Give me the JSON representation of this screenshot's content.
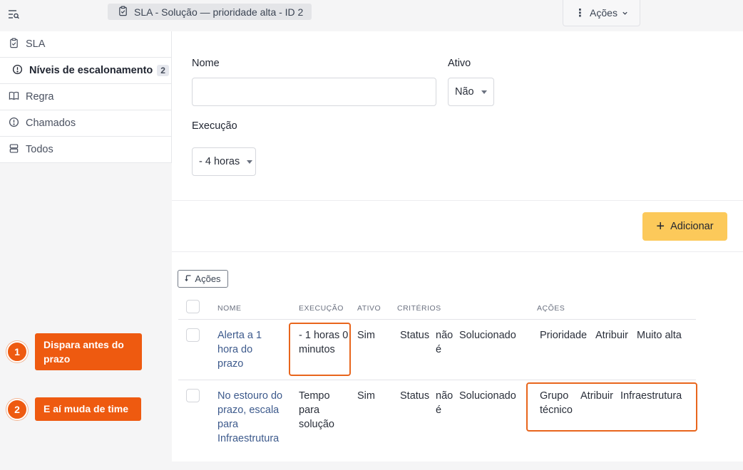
{
  "breadcrumb": {
    "text": "SLA -  Solução — prioridade alta - ID 2"
  },
  "header": {
    "actions_label": "Ações"
  },
  "sidebar": {
    "items": [
      {
        "label": "SLA",
        "icon": "clipboard-check-icon"
      },
      {
        "label": "Níveis de escalonamento",
        "icon": "alert-circle-icon",
        "badge": "2"
      },
      {
        "label": "Regra",
        "icon": "book-icon"
      },
      {
        "label": "Chamados",
        "icon": "alert-circle-icon"
      },
      {
        "label": "Todos",
        "icon": "server-icon"
      }
    ]
  },
  "form": {
    "name_label": "Nome",
    "name_value": "",
    "active_label": "Ativo",
    "active_value": "Não",
    "execution_label": "Execução",
    "execution_value": "- 4 horas",
    "add_button": "Adicionar"
  },
  "table": {
    "mass_actions_label": "Ações",
    "headers": {
      "name": "NOME",
      "execution": "EXECUÇÃO",
      "active": "ATIVO",
      "criteria": "CRITÉRIOS",
      "actions": "AÇÕES"
    },
    "rows": [
      {
        "name": "Alerta a 1 hora do prazo",
        "execution": "- 1 horas 0 minutos",
        "active": "Sim",
        "criteria_field": "Status",
        "criteria_op": "não é",
        "criteria_value": "Solucionado",
        "action_field": "Prioridade",
        "action_type": "Atribuir",
        "action_value": "Muito alta"
      },
      {
        "name": "No estouro do prazo, escala para Infraestrutura",
        "execution": "Tempo para solução",
        "active": "Sim",
        "criteria_field": "Status",
        "criteria_op": "não é",
        "criteria_value": "Solucionado",
        "action_field": "Grupo técnico",
        "action_type": "Atribuir",
        "action_value": "Infraestrutura"
      }
    ]
  },
  "annotations": [
    {
      "number": "1",
      "text": "Dispara antes do prazo"
    },
    {
      "number": "2",
      "text": "E aí muda de time"
    }
  ],
  "colors": {
    "accent": "#ee5a10",
    "add_button": "#fcc95a",
    "link": "#3d5a8c"
  }
}
